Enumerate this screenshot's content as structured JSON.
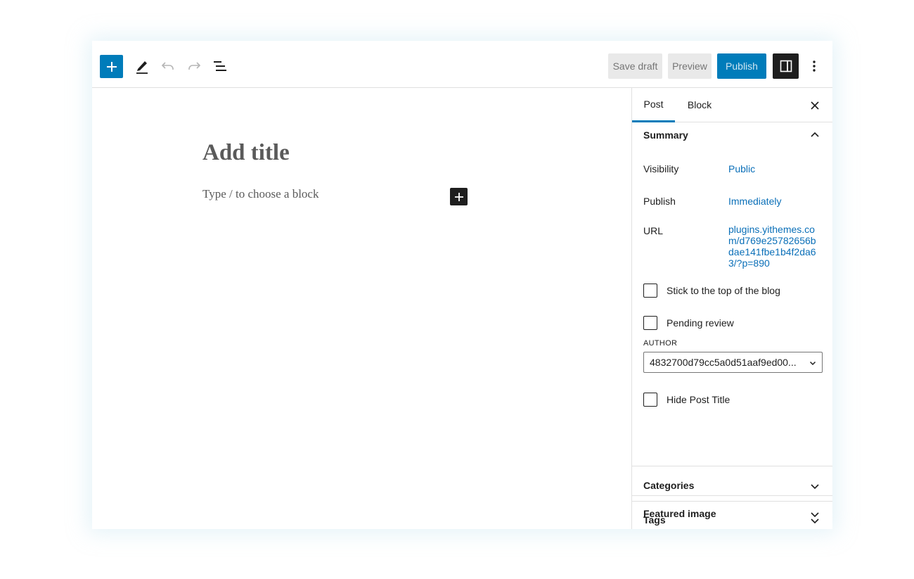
{
  "toolbar": {
    "inserter_icon": "plus-icon",
    "tools_icon": "pencil-icon",
    "undo_icon": "undo-icon",
    "redo_icon": "redo-icon",
    "list_view_icon": "list-view-icon",
    "save_draft_label": "Save draft",
    "preview_label": "Preview",
    "publish_label": "Publish",
    "settings_icon": "sidebar-toggle-icon",
    "more_icon": "more-vertical-icon"
  },
  "editor": {
    "title_placeholder": "Add title",
    "block_placeholder": "Type / to choose a block"
  },
  "sidebar": {
    "tabs": [
      {
        "label": "Post",
        "active": true
      },
      {
        "label": "Block",
        "active": false
      }
    ],
    "summary": {
      "title": "Summary",
      "visibility_label": "Visibility",
      "visibility_value": "Public",
      "publish_label": "Publish",
      "publish_value": "Immediately",
      "url_label": "URL",
      "url_value": "plugins.yithemes.com/d769e25782656bdae141fbe1b4f2da63/?p=890",
      "sticky_label": "Stick to the top of the blog",
      "pending_label": "Pending review",
      "author_label": "AUTHOR",
      "author_value": "4832700d79cc5a0d51aaf9ed00...",
      "hide_title_label": "Hide Post Title"
    },
    "categories_title": "Categories",
    "tags_title": "Tags",
    "featured_image_title": "Featured image"
  },
  "colors": {
    "accent": "#007cba",
    "link": "#0a6fb8",
    "dark": "#1e1e1e"
  }
}
